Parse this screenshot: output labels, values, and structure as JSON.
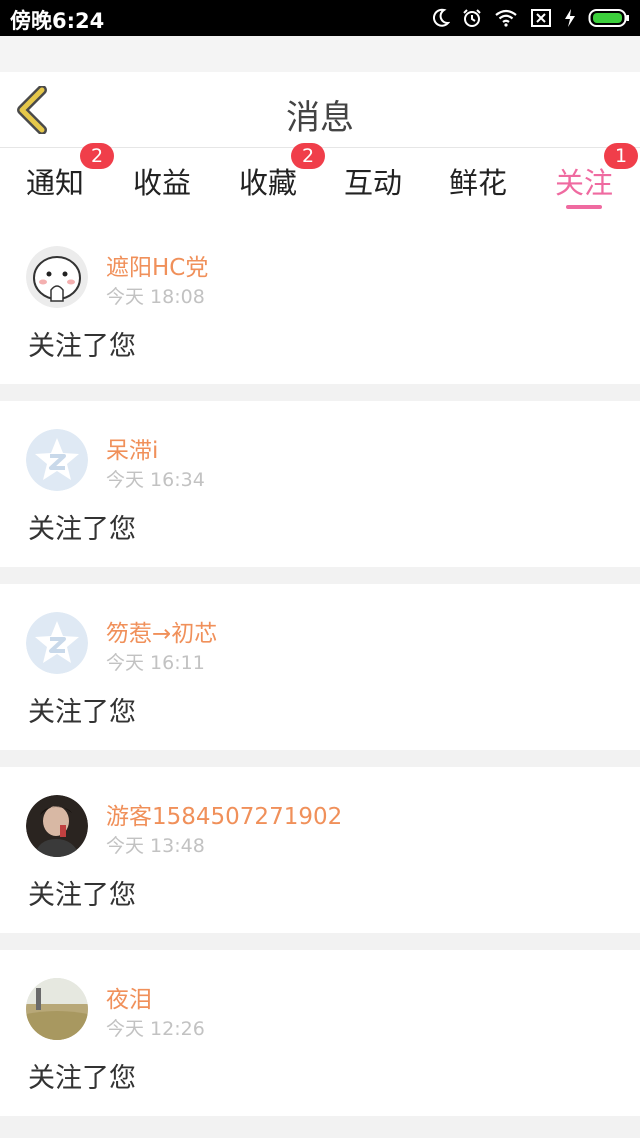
{
  "status_bar": {
    "time": "傍晚6:24",
    "icons": [
      "moon-icon",
      "alarm-icon",
      "wifi-icon",
      "sim-off-icon",
      "charging-icon",
      "battery-icon"
    ]
  },
  "header": {
    "back_icon": "chevron-left-icon",
    "title": "消息"
  },
  "tabs": [
    {
      "label": "通知",
      "badge": "2",
      "active": false
    },
    {
      "label": "收益",
      "badge": "",
      "active": false
    },
    {
      "label": "收藏",
      "badge": "2",
      "active": false
    },
    {
      "label": "互动",
      "badge": "",
      "active": false
    },
    {
      "label": "鲜花",
      "badge": "",
      "active": false
    },
    {
      "label": "关注",
      "badge": "1",
      "active": true
    }
  ],
  "messages": [
    {
      "name": "遮阳HC党",
      "time": "今天 18:08",
      "text": "关注了您",
      "avatar": "cartoon-avatar"
    },
    {
      "name": "呆滞i",
      "time": "今天 16:34",
      "text": "关注了您",
      "avatar": "qzone-default-avatar"
    },
    {
      "name": "笏惹→初芯",
      "time": "今天 16:11",
      "text": "关注了您",
      "avatar": "qzone-default-avatar"
    },
    {
      "name": "游客1584507271902",
      "time": "今天 13:48",
      "text": "关注了您",
      "avatar": "photo-avatar"
    },
    {
      "name": "夜泪",
      "time": "今天 12:26",
      "text": "关注了您",
      "avatar": "landscape-avatar"
    }
  ],
  "colors": {
    "accent": "#ef6aa0",
    "badge": "#f03e4a",
    "name": "#f0905a",
    "back_arrow": "#e0c040"
  }
}
